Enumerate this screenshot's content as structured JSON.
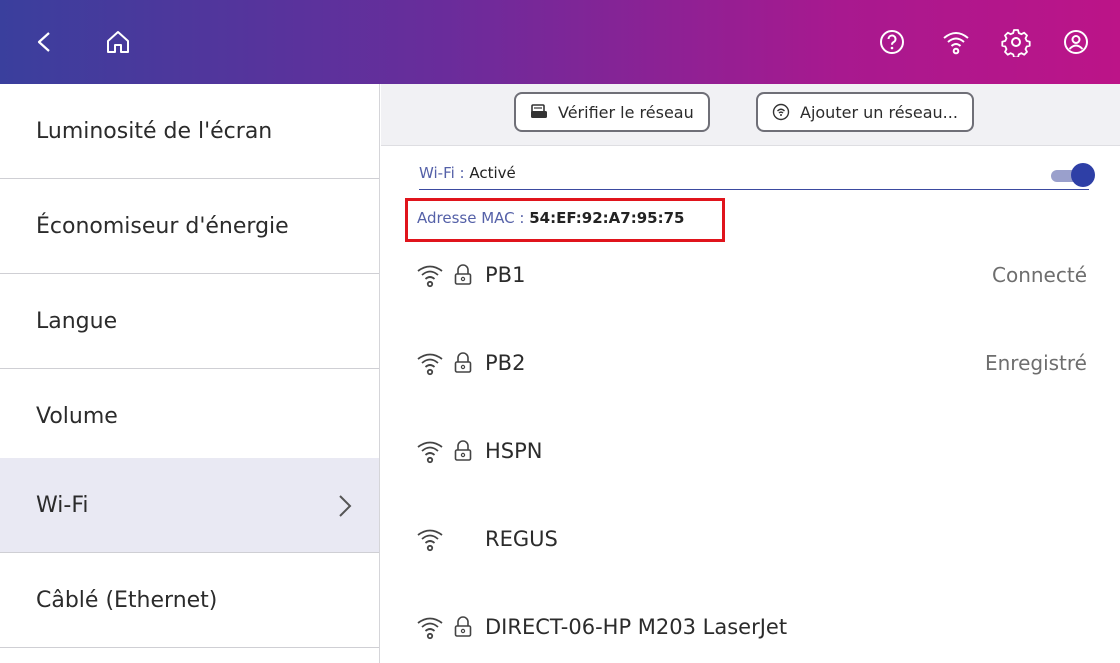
{
  "topbar": {
    "icons": [
      "back-icon",
      "home-icon",
      "help-icon",
      "wifi-icon",
      "settings-icon",
      "account-icon"
    ]
  },
  "sidebar": {
    "items": [
      {
        "label": "Luminosité de l'écran"
      },
      {
        "label": "Économiseur d'énergie"
      },
      {
        "label": "Langue"
      },
      {
        "label": "Volume"
      },
      {
        "label": "Wi-Fi"
      },
      {
        "label": "Câblé (Ethernet)"
      }
    ],
    "active_index": 4
  },
  "toolbar": {
    "check_network_label": "Vérifier le réseau",
    "add_network_label": "Ajouter un réseau..."
  },
  "wifi": {
    "label": "Wi-Fi :",
    "state": "Activé",
    "enabled": true,
    "mac_label": "Adresse MAC :",
    "mac_value": "54:EF:92:A7:95:75"
  },
  "networks": [
    {
      "name": "PB1",
      "secured": true,
      "status": "Connecté"
    },
    {
      "name": "PB2",
      "secured": true,
      "status": "Enregistré"
    },
    {
      "name": "HSPN",
      "secured": true,
      "status": ""
    },
    {
      "name": "REGUS",
      "secured": false,
      "status": ""
    },
    {
      "name": "DIRECT-06-HP M203 LaserJet",
      "secured": true,
      "status": ""
    }
  ],
  "colors": {
    "accent": "#2e3fa6",
    "highlight_box": "#e0141c",
    "active_menu_bg": "#e9e9f3"
  }
}
